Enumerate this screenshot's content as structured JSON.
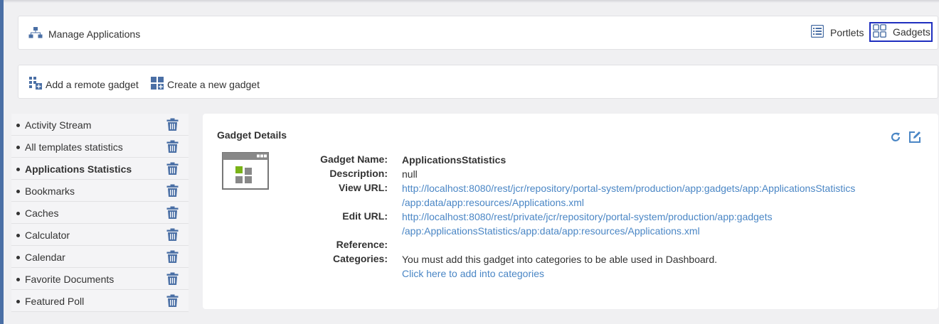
{
  "header": {
    "title": "Manage Applications",
    "tabs": [
      {
        "label": "Portlets",
        "icon": "list-icon"
      },
      {
        "label": "Gadgets",
        "icon": "grid-icon"
      }
    ]
  },
  "actions": {
    "add_remote": "Add a remote gadget",
    "create_new": "Create a new gadget"
  },
  "gadget_list": [
    {
      "label": "Activity Stream"
    },
    {
      "label": "All templates statistics"
    },
    {
      "label": "Applications Statistics"
    },
    {
      "label": "Bookmarks"
    },
    {
      "label": "Caches"
    },
    {
      "label": "Calculator"
    },
    {
      "label": "Calendar"
    },
    {
      "label": "Favorite Documents"
    },
    {
      "label": "Featured Poll"
    }
  ],
  "details": {
    "title": "Gadget Details",
    "labels": {
      "name": "Gadget Name:",
      "description": "Description:",
      "view_url": "View URL:",
      "edit_url": "Edit URL:",
      "reference": "Reference:",
      "categories": "Categories:"
    },
    "name": "ApplicationsStatistics",
    "description": "null",
    "view_url_line1": "http://localhost:8080/rest/jcr/repository/portal-system/production/app:gadgets/app:ApplicationsStatistics",
    "view_url_line2": "/app:data/app:resources/Applications.xml",
    "edit_url_line1": "http://localhost:8080/rest/private/jcr/repository/portal-system/production/app:gadgets",
    "edit_url_line2": "/app:ApplicationsStatistics/app:data/app:resources/Applications.xml",
    "reference": "",
    "categories_text": "You must add this gadget into categories to be able used in Dashboard.",
    "categories_link": "Click here to add into categories"
  },
  "colors": {
    "accent": "#4a86c5",
    "active_tab_border": "#1f2fbf",
    "left_stripe": "#4a6fa5"
  }
}
